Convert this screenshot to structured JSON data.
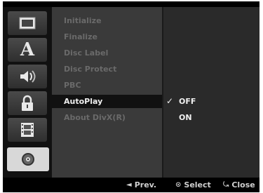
{
  "sidebar": {
    "icons": [
      {
        "name": "display-icon"
      },
      {
        "name": "language-icon",
        "glyph": "A"
      },
      {
        "name": "audio-icon"
      },
      {
        "name": "lock-icon"
      },
      {
        "name": "recording-icon"
      },
      {
        "name": "disc-icon"
      }
    ],
    "active_index": 5
  },
  "menu": {
    "items": [
      {
        "label": "Initialize"
      },
      {
        "label": "Finalize"
      },
      {
        "label": "Disc Label"
      },
      {
        "label": "Disc Protect"
      },
      {
        "label": "PBC"
      },
      {
        "label": "AutoPlay"
      },
      {
        "label": "About DivX(R)"
      }
    ],
    "selected_index": 5
  },
  "options": {
    "items": [
      {
        "label": "OFF",
        "checked": true
      },
      {
        "label": "ON",
        "checked": false
      }
    ],
    "check_glyph": "✓"
  },
  "footer": {
    "prev_label": "Prev.",
    "prev_icon": "◄",
    "select_label": "Select",
    "select_icon": "⊙",
    "close_label": "Close",
    "close_icon": "⤿"
  },
  "colors": {
    "background": "#000000",
    "menu_panel": "#3a3a3a",
    "options_panel": "#2a2a2a",
    "selected_row": "#111111",
    "disabled_text": "#6a6a6a",
    "active_text": "#f0f0f0"
  }
}
